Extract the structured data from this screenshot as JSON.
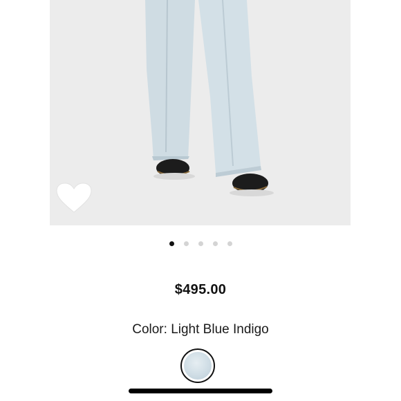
{
  "product": {
    "price": "$495.00",
    "color_line": "Color: Light Blue Indigo",
    "selected_color": "Light Blue Indigo",
    "swatch_color": "#cfdde5"
  },
  "carousel": {
    "total_images": 5,
    "active_index": 0
  },
  "icons": {
    "favorite": "heart-icon"
  },
  "colors": {
    "text": "#111111",
    "dot_active": "#111111",
    "dot_inactive": "#d4d4d4",
    "image_bg": "#ececec"
  }
}
